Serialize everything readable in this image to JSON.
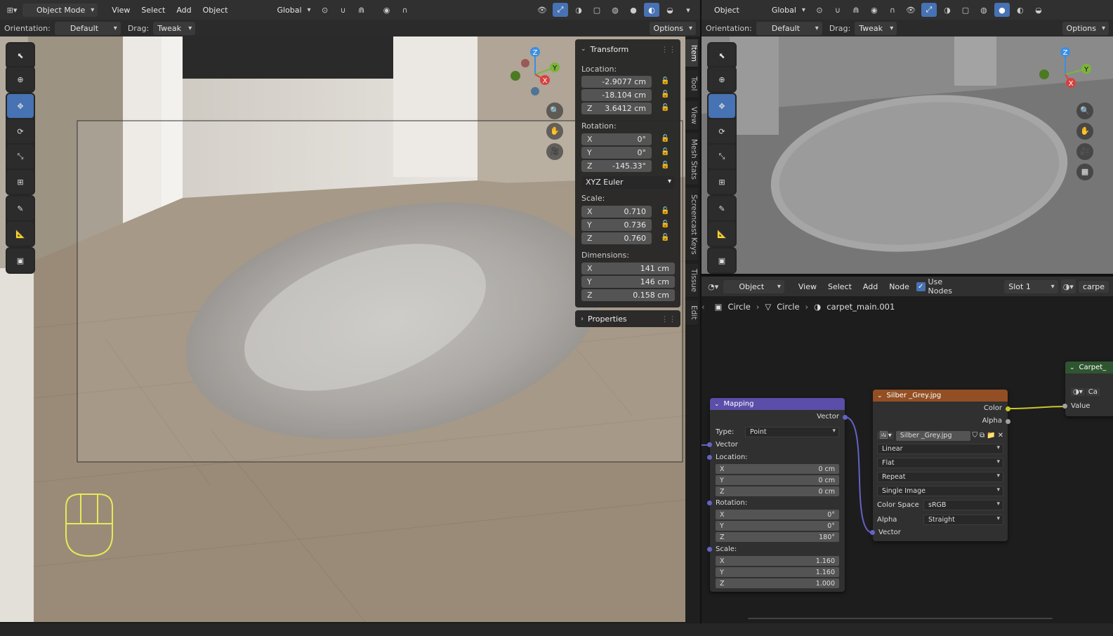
{
  "left_header": {
    "mode": "Object Mode",
    "menus": [
      "View",
      "Select",
      "Add",
      "Object"
    ],
    "transform_orientation": "Global"
  },
  "left_toolbar": {
    "orientation_label": "Orientation:",
    "orientation_value": "Default",
    "drag_label": "Drag:",
    "drag_value": "Tweak",
    "options": "Options"
  },
  "right_header": {
    "menu": "Object",
    "transform_orientation": "Global"
  },
  "right_toolbar": {
    "orientation_label": "Orientation:",
    "orientation_value": "Default",
    "drag_label": "Drag:",
    "drag_value": "Tweak",
    "options": "Options"
  },
  "gizmo": {
    "x": "X",
    "y": "Y",
    "z": "Z"
  },
  "transform_panel": {
    "title": "Transform",
    "location_label": "Location:",
    "location": [
      {
        "axis": "",
        "value": "-2.9077 cm"
      },
      {
        "axis": "",
        "value": "-18.104 cm"
      },
      {
        "axis": "Z",
        "value": "3.6412 cm"
      }
    ],
    "rotation_label": "Rotation:",
    "rotation": [
      {
        "axis": "X",
        "value": "0°"
      },
      {
        "axis": "Y",
        "value": "0°"
      },
      {
        "axis": "Z",
        "value": "-145.33°"
      }
    ],
    "rotation_mode": "XYZ Euler",
    "scale_label": "Scale:",
    "scale": [
      {
        "axis": "X",
        "value": "0.710"
      },
      {
        "axis": "Y",
        "value": "0.736"
      },
      {
        "axis": "Z",
        "value": "0.760"
      }
    ],
    "dimensions_label": "Dimensions:",
    "dimensions": [
      {
        "axis": "X",
        "value": "141 cm"
      },
      {
        "axis": "Y",
        "value": "146 cm"
      },
      {
        "axis": "Z",
        "value": "0.158 cm"
      }
    ],
    "properties_title": "Properties"
  },
  "side_tabs": [
    "Item",
    "Tool",
    "View",
    "Mesh Stats",
    "Screencast Keys",
    "Tissue",
    "Edit"
  ],
  "node_header": {
    "type": "Object",
    "menus": [
      "View",
      "Select",
      "Add",
      "Node"
    ],
    "use_nodes_label": "Use Nodes",
    "use_nodes_checked": true,
    "slot": "Slot 1",
    "material": "carpe"
  },
  "breadcrumb": {
    "object": "Circle",
    "mesh": "Circle",
    "material": "carpet_main.001"
  },
  "mapping_node": {
    "title": "Mapping",
    "out_vector": "Vector",
    "type_label": "Type:",
    "type_value": "Point",
    "in_vector": "Vector",
    "location_label": "Location:",
    "location": [
      {
        "axis": "X",
        "value": "0 cm"
      },
      {
        "axis": "Y",
        "value": "0 cm"
      },
      {
        "axis": "Z",
        "value": "0 cm"
      }
    ],
    "rotation_label": "Rotation:",
    "rotation": [
      {
        "axis": "X",
        "value": "0°"
      },
      {
        "axis": "Y",
        "value": "0°"
      },
      {
        "axis": "Z",
        "value": "180°"
      }
    ],
    "scale_label": "Scale:",
    "scale": [
      {
        "axis": "X",
        "value": "1.160"
      },
      {
        "axis": "Y",
        "value": "1.160"
      },
      {
        "axis": "Z",
        "value": "1.000"
      }
    ]
  },
  "image_node": {
    "title": "Silber _Grey.jpg",
    "out_color": "Color",
    "out_alpha": "Alpha",
    "image_name": "Silber _Grey.jpg",
    "interpolation": "Linear",
    "projection": "Flat",
    "extension": "Repeat",
    "source": "Single Image",
    "color_space_label": "Color Space",
    "color_space": "sRGB",
    "alpha_label": "Alpha",
    "alpha_value": "Straight",
    "in_vector": "Vector"
  },
  "carpet_node": {
    "title": "Carpet_",
    "field": "Ca",
    "in_value": "Value"
  },
  "colors": {
    "accent": "#4772b3",
    "mapping_header": "#5a4ea8",
    "image_header": "#934f23",
    "carpet_header": "#2f5530",
    "vector_socket": "#6363c7",
    "color_socket": "#c7c729",
    "value_socket": "#a1a1a1"
  }
}
